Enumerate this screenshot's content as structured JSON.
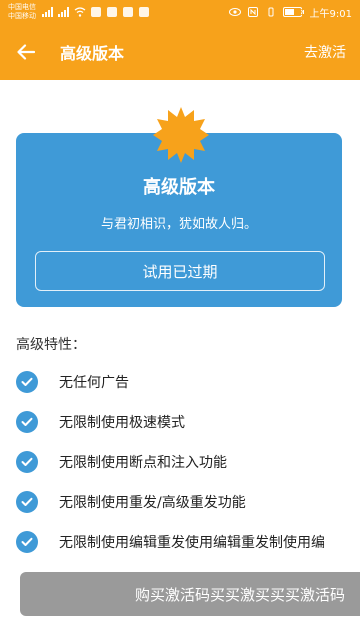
{
  "status": {
    "carrier_top": "中国电信",
    "carrier_bottom": "中国移动",
    "battery": "53",
    "time": "上午9:01"
  },
  "appbar": {
    "title": "高级版本",
    "activate": "去激活"
  },
  "card": {
    "title": "高级版本",
    "subtitle": "与君初相识，犹如故人归。",
    "trial_button": "试用已过期"
  },
  "features": {
    "title": "高级特性：",
    "items": [
      "无任何广告",
      "无限制使用极速模式",
      "无限制使用断点和注入功能",
      "无限制使用重发/高级重发功能",
      "无限制使用编辑重发使用编辑重发制使用编"
    ]
  },
  "buy_button": "购买激活码买买激买买买激活码",
  "colors": {
    "primary_orange": "#F7A21B",
    "card_blue": "#3F9AD7",
    "buy_gray": "#9A9A9A"
  }
}
